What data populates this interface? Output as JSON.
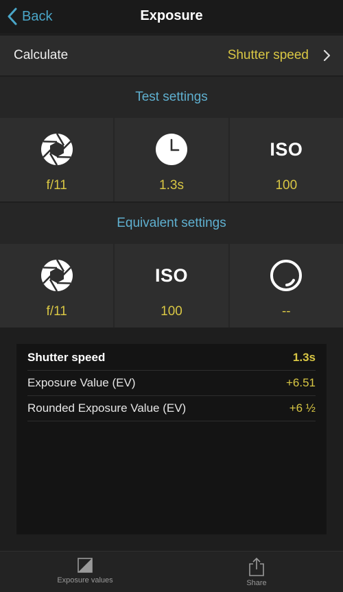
{
  "navbar": {
    "back_label": "Back",
    "title": "Exposure"
  },
  "calculate": {
    "label": "Calculate",
    "value": "Shutter speed"
  },
  "test_settings": {
    "header": "Test settings",
    "cells": [
      {
        "icon": "aperture-icon",
        "value": "f/11"
      },
      {
        "icon": "clock-icon",
        "value": "1.3s"
      },
      {
        "icon": "iso-icon",
        "label": "ISO",
        "value": "100"
      }
    ]
  },
  "equivalent_settings": {
    "header": "Equivalent settings",
    "cells": [
      {
        "icon": "aperture-icon",
        "value": "f/11"
      },
      {
        "icon": "iso-icon",
        "label": "ISO",
        "value": "100"
      },
      {
        "icon": "shutter-ring-icon",
        "value": "--"
      }
    ]
  },
  "results": [
    {
      "label": "Shutter speed",
      "value": "1.3s",
      "emphasis": true
    },
    {
      "label": "Exposure Value (EV)",
      "value": "+6.51"
    },
    {
      "label": "Rounded Exposure Value (EV)",
      "value": "+6 ½"
    }
  ],
  "tabbar": {
    "exposure_values_label": "Exposure values",
    "share_label": "Share"
  },
  "colors": {
    "accent_blue": "#4aa6c8",
    "value_yellow": "#d9c744"
  }
}
